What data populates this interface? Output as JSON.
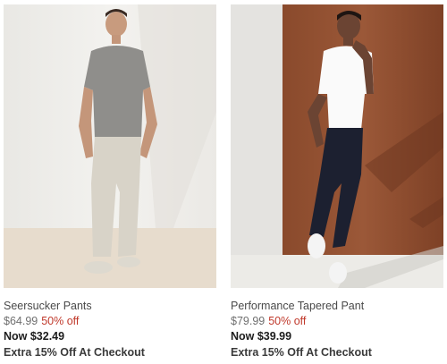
{
  "products": [
    {
      "image_alt": "man-in-grey-tee-and-light-pants",
      "name": "Seersucker Pants",
      "original_price": "$64.99",
      "discount": "50% off",
      "sale_price": "Now $32.49",
      "promo": "Extra 15% Off At Checkout"
    },
    {
      "image_alt": "man-in-white-tee-and-navy-pants",
      "name": "Performance Tapered Pant",
      "original_price": "$79.99",
      "discount": "50% off",
      "sale_price": "Now $39.99",
      "promo": "Extra 15% Off At Checkout"
    }
  ],
  "colors": {
    "discount_red": "#c0392b",
    "text_dark": "#1c1c1c",
    "text_grey": "#6f6f6f"
  }
}
